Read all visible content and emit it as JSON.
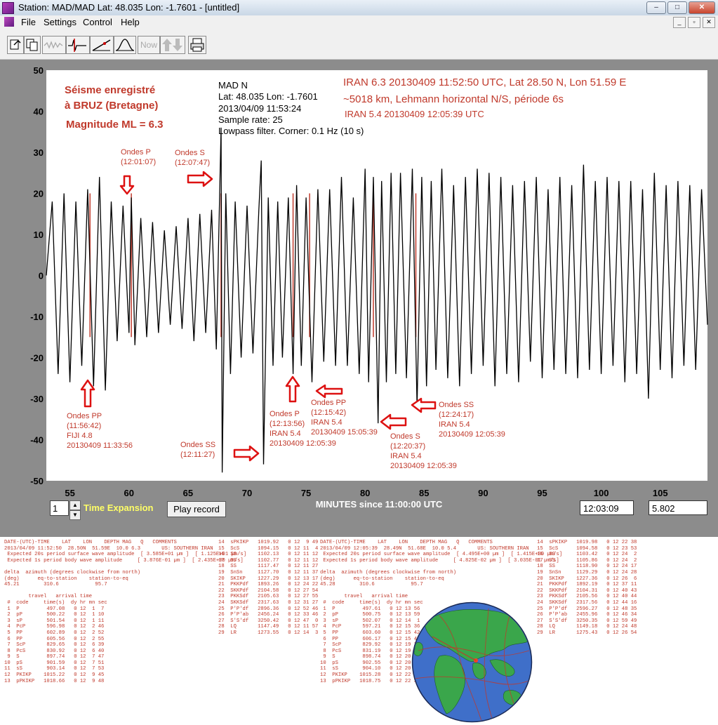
{
  "window": {
    "title": "Station: MAD/MAD Lat: 48.035 Lon: -1.7601 - [untitled]",
    "controls": [
      "–",
      "□",
      "✕"
    ]
  },
  "menu": {
    "items": [
      "File",
      "Settings",
      "Control",
      "Help"
    ],
    "mdi_controls": [
      "_",
      "▫",
      "✕"
    ]
  },
  "toolbar": {
    "buttons": [
      {
        "name": "open-file-icon"
      },
      {
        "name": "open-multiple-icon"
      },
      {
        "name": "waveform-icon"
      },
      {
        "name": "filter-wave-icon"
      },
      {
        "name": "pick-icon"
      },
      {
        "name": "spectrum-icon"
      },
      {
        "name": "now-button",
        "label": "Now"
      },
      {
        "name": "up-down-arrows-icon"
      },
      {
        "name": "printer-icon"
      }
    ]
  },
  "chart_data": {
    "type": "line",
    "xlabel": "MINUTES since 11:00:00 UTC",
    "ylabel": "",
    "xlim": [
      53,
      109
    ],
    "ylim": [
      -50,
      50
    ],
    "xticks": [
      55,
      60,
      65,
      70,
      75,
      80,
      85,
      90,
      95,
      100,
      105
    ],
    "yticks": [
      50,
      40,
      30,
      20,
      10,
      0,
      -10,
      -20,
      -30,
      -40,
      -50
    ],
    "grid": false,
    "series": [
      {
        "color": "#000000",
        "points": [
          [
            53.0,
            0
          ],
          [
            53.5,
            18
          ],
          [
            54.0,
            -24
          ],
          [
            54.5,
            20
          ],
          [
            55.0,
            -26
          ],
          [
            55.5,
            18
          ],
          [
            56.0,
            -22
          ],
          [
            56.5,
            21
          ],
          [
            57.0,
            -27
          ],
          [
            57.5,
            24
          ],
          [
            58.0,
            -28
          ],
          [
            58.5,
            18
          ],
          [
            59.0,
            -16
          ],
          [
            59.5,
            17
          ],
          [
            60.0,
            -14
          ],
          [
            60.2,
            19
          ],
          [
            60.5,
            -17
          ],
          [
            61.0,
            14
          ],
          [
            61.5,
            -15
          ],
          [
            62.0,
            13
          ],
          [
            62.5,
            -14
          ],
          [
            63.0,
            11
          ],
          [
            63.5,
            -12
          ],
          [
            64.0,
            12
          ],
          [
            64.5,
            -13
          ],
          [
            65.0,
            14
          ],
          [
            65.5,
            -16
          ],
          [
            66.0,
            15
          ],
          [
            66.5,
            -14
          ],
          [
            67.0,
            16
          ],
          [
            67.4,
            -18
          ],
          [
            67.8,
            36
          ],
          [
            67.9,
            -48
          ],
          [
            68.2,
            20
          ],
          [
            68.6,
            -24
          ],
          [
            69.0,
            18
          ],
          [
            69.5,
            -20
          ],
          [
            70.0,
            17
          ],
          [
            70.5,
            -19
          ],
          [
            71.0,
            16
          ],
          [
            71.2,
            28
          ],
          [
            71.4,
            -46
          ],
          [
            71.8,
            19
          ],
          [
            72.2,
            -22
          ],
          [
            72.6,
            18
          ],
          [
            73.0,
            -20
          ],
          [
            73.5,
            19
          ],
          [
            73.9,
            -24
          ],
          [
            74.2,
            22
          ],
          [
            74.6,
            -22
          ],
          [
            75.0,
            19
          ],
          [
            75.5,
            -26
          ],
          [
            76.0,
            21
          ],
          [
            76.5,
            -21
          ],
          [
            77.0,
            21
          ],
          [
            77.5,
            -22
          ],
          [
            78.0,
            24
          ],
          [
            78.5,
            -22
          ],
          [
            79.0,
            19
          ],
          [
            79.5,
            -24
          ],
          [
            80.0,
            26
          ],
          [
            80.3,
            -26
          ],
          [
            80.7,
            24
          ],
          [
            81.1,
            -36
          ],
          [
            81.4,
            23
          ],
          [
            81.8,
            -26
          ],
          [
            82.2,
            25
          ],
          [
            82.6,
            -24
          ],
          [
            83.0,
            25
          ],
          [
            83.5,
            -25
          ],
          [
            84.0,
            26
          ],
          [
            84.4,
            -32
          ],
          [
            84.8,
            24
          ],
          [
            85.2,
            -27
          ],
          [
            85.6,
            23
          ],
          [
            86.0,
            -23
          ],
          [
            86.5,
            26
          ],
          [
            87.0,
            -25
          ],
          [
            87.5,
            22
          ],
          [
            88.0,
            -27
          ],
          [
            88.5,
            24
          ],
          [
            89.0,
            -24
          ],
          [
            89.5,
            26
          ],
          [
            90.0,
            -22
          ],
          [
            90.5,
            25
          ],
          [
            91.0,
            -27
          ],
          [
            91.5,
            24
          ],
          [
            92.0,
            -24
          ],
          [
            92.5,
            22
          ],
          [
            93.0,
            -26
          ],
          [
            93.5,
            23
          ],
          [
            94.0,
            -21
          ],
          [
            94.5,
            24
          ],
          [
            95.0,
            -25
          ],
          [
            95.5,
            21
          ],
          [
            96.0,
            -23
          ],
          [
            96.5,
            24
          ],
          [
            97.0,
            -24
          ],
          [
            97.5,
            22
          ],
          [
            98.0,
            -25
          ],
          [
            98.5,
            27
          ],
          [
            99.0,
            -23
          ],
          [
            99.5,
            23
          ],
          [
            100.0,
            -24
          ],
          [
            100.5,
            24
          ],
          [
            101.0,
            -22
          ],
          [
            101.5,
            23
          ],
          [
            102.0,
            -26
          ],
          [
            102.5,
            23
          ],
          [
            103.0,
            -24
          ],
          [
            103.5,
            21
          ],
          [
            104.0,
            -30
          ],
          [
            104.5,
            25
          ],
          [
            105.0,
            -23
          ],
          [
            105.5,
            22
          ],
          [
            106.0,
            -25
          ],
          [
            106.5,
            23
          ],
          [
            107.0,
            -22
          ],
          [
            107.5,
            22
          ],
          [
            108.0,
            -23
          ],
          [
            108.5,
            21
          ],
          [
            109.0,
            -12
          ]
        ]
      }
    ],
    "phase_markers": [
      56.7,
      60.2,
      67.8,
      73.9,
      75.3,
      80.7,
      84.3
    ],
    "annotations": {
      "left_title": [
        "Séisme enregistré",
        "à BRUZ (Bretagne)",
        "Magnitude ML = 6.3"
      ],
      "station_info": [
        "MAD  N",
        "Lat: 48.035 Lon: -1.7601",
        "2013/04/09 11:53:24",
        "Sample rate: 25",
        "Lowpass filter. Corner: 0.1 Hz (10 s)"
      ],
      "right_title": [
        "IRAN 6.3 20130409 11:52:50 UTC, Lat 28.50 N, Lon 51.59 E",
        "~5018 km, Lehmann horizontal N/S, période 6s",
        "IRAN 5.4 20130409 12:05:39 UTC"
      ],
      "phases": [
        {
          "lines": [
            "Ondes P",
            "(12:01:07)"
          ]
        },
        {
          "lines": [
            "Ondes S",
            "(12:07:47)"
          ]
        },
        {
          "lines": [
            "Ondes PP",
            "(11:56:42)",
            "FIJI 4.8",
            "20130409 11:33:56"
          ]
        },
        {
          "lines": [
            "Ondes SS",
            "(12:11:27)"
          ]
        },
        {
          "lines": [
            "Ondes P",
            "(12:13:56)",
            "IRAN 5.4",
            "20130409 12:05:39"
          ]
        },
        {
          "lines": [
            "Ondes PP",
            "(12:15:42)",
            "IRAN 5.4",
            "20130409 15:05:39"
          ]
        },
        {
          "lines": [
            "Ondes S",
            "(12:20:37)",
            "IRAN 5.4",
            "20130409 12:05:39"
          ]
        },
        {
          "lines": [
            "Ondes SS",
            "(12:24:17)",
            "IRAN 5.4",
            "20130409 12:05:39"
          ]
        }
      ]
    }
  },
  "controls": {
    "time_expansion_value": "1",
    "time_expansion_label": "Time Expansion",
    "play_button": "Play record",
    "time_readout": "12:03:09",
    "value_readout": "5.802"
  },
  "tables": {
    "t1": "DATE-(UTC)-TIME    LAT    LON    DEPTH MAG   Q   COMMENTS\n2013/04/09 11:52:50  28.50N  51.59E  10.0 6.3       US: SOUTHERN IRAN\n Expected 20s period surface wave amplitude  [ 3.585E+01 µm ]  [ 1.125E+01 µm/s]\n Expected 1s period body wave amplitude     [ 3.876E-01 µm ]  [ 2.435E+00 µm/s]\n\ndelta  azimuth (degrees clockwise from north)\n(deg)      eq-to-station    station-to-eq\n45.21        310.6            95.7\n\n        travel   arrival time\n #  code     time(s)  dy hr mn sec\n 1  P         497.08   0 12  1  7\n 2  pP        500.22   0 12  1 10\n 3  sP        501.54   0 12  1 11\n 4  PcP       596.98   0 12  2 46\n 5  PP        602.89   0 12  2 52\n 6  PP        605.56   0 12  2 55\n 7  ScP       829.65   0 12  6 39\n 8  PcS       830.92   0 12  6 40\n 9  S         897.74   0 12  7 47\n10  pS        901.59   0 12  7 51\n11  sS        903.14   0 12  7 53\n12  PKIKP    1015.22   0 12  9 45\n13  pPKIKP   1018.66   0 12  9 48",
    "t2": "14  sPKIKP   1019.92   0 12  9 49\n15  ScS      1094.15   0 12 11  4\n16  SS       1102.13   0 12 11 12\n17  SS       1102.77   0 12 11 12\n18  SS       1117.47   0 12 11 27\n19  SnSn     1127.70   0 12 11 37\n20  SKIKP    1227.29   0 12 13 17\n21  PKKPdf   1893.26   0 12 24 22\n22  SKKPdf   2104.58   0 12 27 54\n23  PKKSdf   2105.63   0 12 27 55\n24  SKKSdf   2317.63   0 12 31 27\n25  P'P'df   2896.36   0 12 52 46\n26  P'P'ab   2456.24   0 12 33 46\n27  S'S'df   3250.42   0 12 47  0\n28  LQ       1147.49   0 12 11 57\n29  LR       1273.55   0 12 14  3",
    "t3": "DATE-(UTC)-TIME    LAT    LON    DEPTH MAG   Q   COMMENTS\n2013/04/09 12:05:39  28.49N  51.68E  10.0 5.4       US: SOUTHERN IRAN\n Expected 20s period surface wave amplitude  [ 4.495E+00 µm ]  [ 1.415E+00 µm/s]\n Expected 1s period body wave amplitude     [ 4.825E-02 µm ]  [ 3.035E-01 µm/s]\n\ndelta  azimuth (degrees clockwise from north)\n(deg)      eq-to-station    station-to-eq\n45.28        310.6            95.7\n\n        travel   arrival time\n #  code     time(s)  dy hr mn sec\n 1  P         497.61   0 12 13 56\n 2  pP        500.75   0 12 13 59\n 3  sP        502.07   0 12 14  1\n 4  PcP       597.21   0 12 15 36\n 5  PP        603.60   0 12 15 42\n 6  PP        606.17   0 12 15 45\n 7  ScP       829.92   0 12 19 28\n 8  PcS       831.19   0 12 19 30\n 9  S         898.74   0 12 20 37\n10  pS        902.55   0 12 20 41\n11  sS        904.10   0 12 20 43\n12  PKIKP    1015.28   0 12 22 34\n13  pPKIKP   1018.75   0 12 22 37",
    "t4": "14  sPKIKP   1019.98   0 12 22 38\n15  ScS      1094.58   0 12 23 53\n16  SS       1103.42   0 12 24  2\n17  SS       1105.86   0 12 24  2\n18  SS       1118.90   0 12 24 17\n19  SnSn     1129.29   0 12 24 28\n20  SKIKP    1227.36   0 12 26  6\n21  PKKPdf   1892.19   0 12 37 11\n22  SKKPdf   2104.31   0 12 40 43\n23  PKKSdf   2105.56   0 12 40 44\n24  SKKSdf   2317.56   0 12 44 16\n25  P'P'df   2596.27   0 12 48 35\n26  P'P'ab   2455.96   0 12 46 34\n27  S'S'df   3250.35   0 12 59 49\n28  LQ       1149.18   0 12 24 48\n29  LR       1275.43   0 12 26 54"
  },
  "colors": {
    "annotation": "#c0392b",
    "plot_bg": "#ffffff",
    "panel_bg": "#8c8c8c",
    "trace": "#000000",
    "yellow_label": "#ffff66"
  }
}
